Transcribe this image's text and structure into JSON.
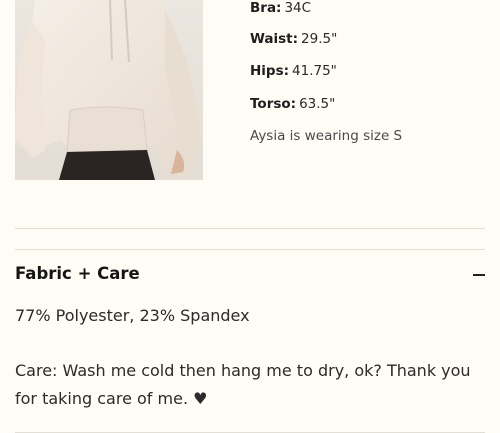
{
  "fit": {
    "measurements": [
      {
        "label": "Bra:",
        "value": "34C"
      },
      {
        "label": "Waist:",
        "value": "29.5\""
      },
      {
        "label": "Hips:",
        "value": "41.75\""
      },
      {
        "label": "Torso:",
        "value": "63.5\""
      }
    ],
    "wearing_note": "Aysia is wearing size S"
  },
  "fabric_care": {
    "title": "Fabric + Care",
    "toggle_icon": "minus-icon",
    "composition": "77% Polyester, 23% Spandex",
    "care": "Care: Wash me cold then hang me to dry, ok? Thank you for taking care of me. ♥"
  },
  "colors": {
    "background": "#fffbf5",
    "divider": "#e2ddd5",
    "hoodie": "#f1e8df",
    "leggings": "#2a2522"
  }
}
